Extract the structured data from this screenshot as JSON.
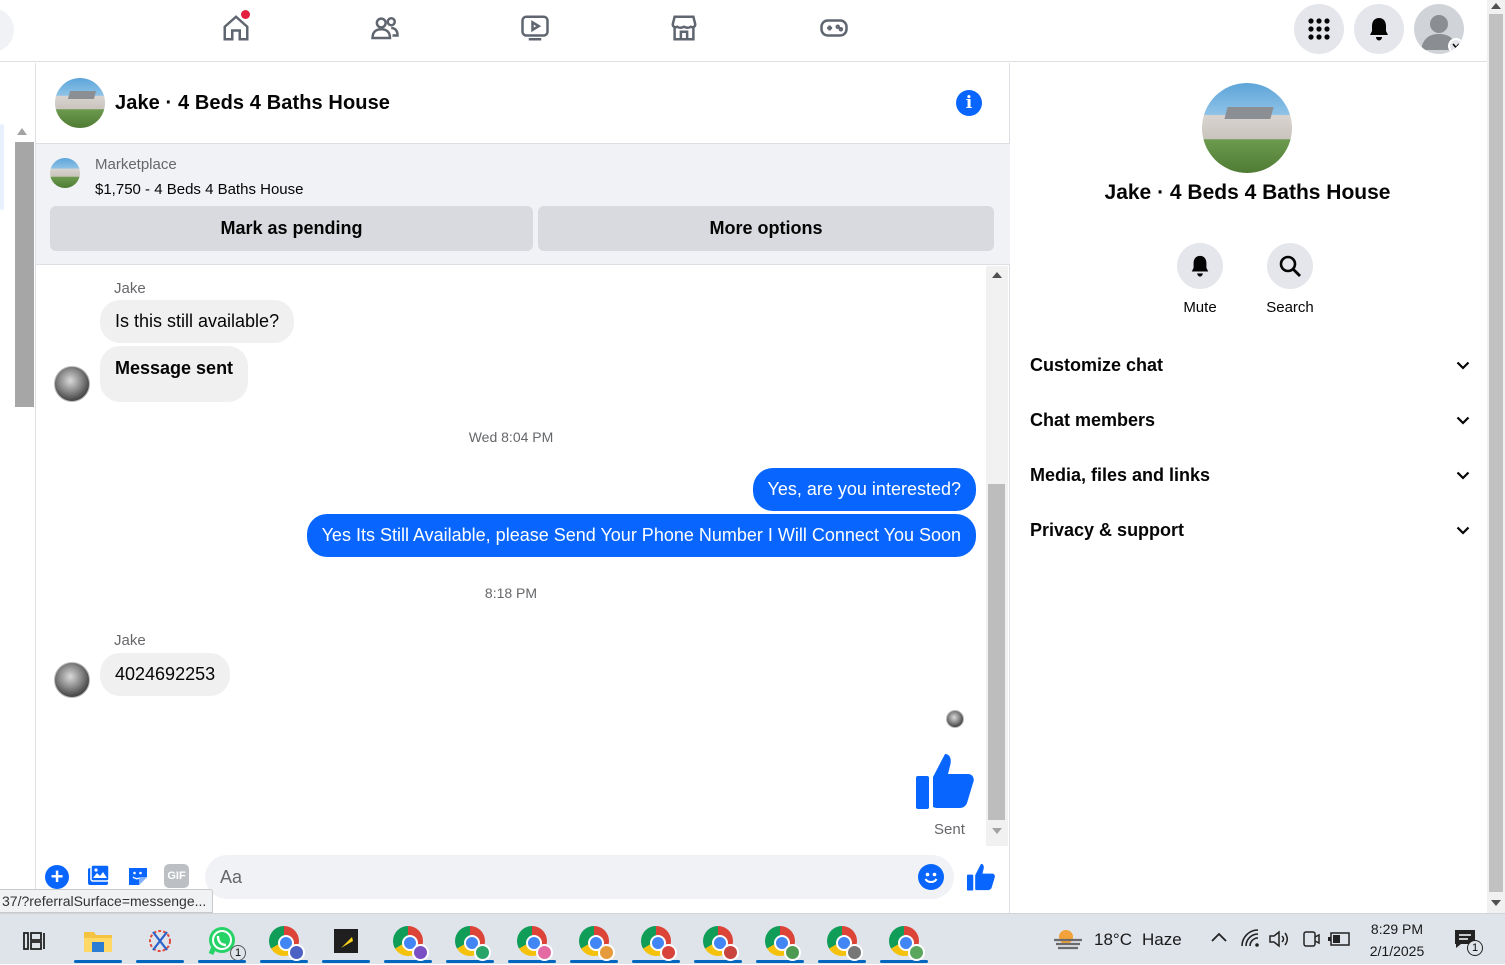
{
  "nav": {
    "icons": [
      "home-icon",
      "friends-icon",
      "video-icon",
      "marketplace-icon",
      "gaming-icon",
      "menu-grid-icon",
      "notifications-icon",
      "account-icon"
    ]
  },
  "chat": {
    "title": "Jake · 4 Beds 4 Baths House",
    "marketplace": {
      "label": "Marketplace",
      "item": "$1,750 - 4 Beds 4 Baths House",
      "mark_pending": "Mark as pending",
      "more_options": "More options"
    },
    "messages": {
      "sender1": "Jake",
      "msg1": "Is this still available?",
      "msg2": "Message sent",
      "time1": "Wed 8:04 PM",
      "out1": "Yes, are you interested?",
      "out2": "Yes Its Still Available, please Send Your Phone Number I Will Connect You Soon",
      "time2": "8:18 PM",
      "sender2": "Jake",
      "msg3": "4024692253",
      "sent_status": "Sent"
    },
    "composer": {
      "placeholder": "Aa"
    }
  },
  "panel": {
    "name": "Jake · 4 Beds 4 Baths House",
    "mute": "Mute",
    "search": "Search",
    "sections": [
      "Customize chat",
      "Chat members",
      "Media, files and links",
      "Privacy & support"
    ]
  },
  "statusbar": {
    "url": "37/?referralSurface=messenge..."
  },
  "taskbar": {
    "weather_temp": "18°C",
    "weather_desc": "Haze",
    "time": "8:29 PM",
    "date": "2/1/2025",
    "whatsapp_badge": "1",
    "notif_badge": "1",
    "colors": {
      "accent": "#0866ff",
      "taskbar": "#dfe3ea"
    }
  }
}
